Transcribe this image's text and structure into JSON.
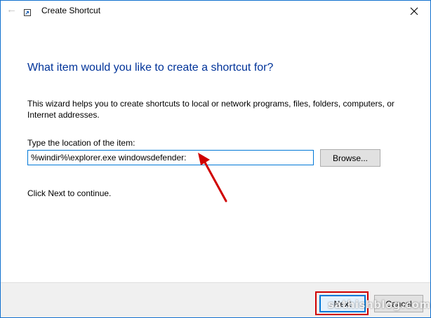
{
  "window": {
    "title": "Create Shortcut",
    "border_color": "#1170cf"
  },
  "titlebar": {
    "back_icon": "back-arrow-icon",
    "app_icon": "shortcut-icon",
    "close_icon": "close-icon"
  },
  "content": {
    "heading": "What item would you like to create a shortcut for?",
    "description": "This wizard helps you to create shortcuts to local or network programs, files, folders, computers, or Internet addresses.",
    "input_label": "Type the location of the item:",
    "input_value": "%windir%\\explorer.exe windowsdefender:",
    "browse_label": "Browse...",
    "hint": "Click Next to continue."
  },
  "footer": {
    "next_label": "Next",
    "cancel_label": "Cancel"
  },
  "watermark": "sathishblog.com",
  "colors": {
    "heading": "#003399",
    "annotation": "#d00000",
    "input_border": "#0078d7"
  }
}
